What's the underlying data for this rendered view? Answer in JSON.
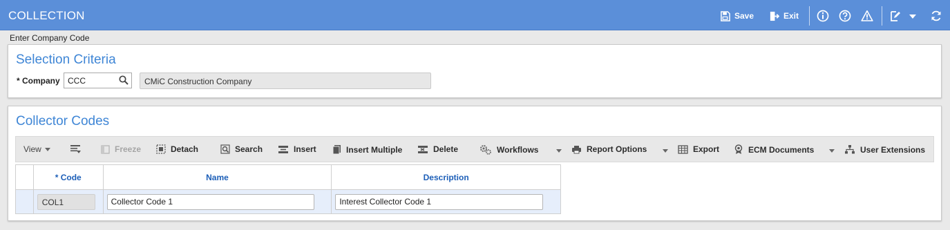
{
  "header": {
    "title": "COLLECTION",
    "save_label": "Save",
    "exit_label": "Exit",
    "bg_color": "#5b8fd9"
  },
  "hint": "Enter Company Code",
  "selection": {
    "title": "Selection Criteria",
    "company_label": "* Company",
    "company_value": "CCC",
    "company_name": "CMiC Construction Company"
  },
  "collector": {
    "title": "Collector Codes",
    "toolbar": {
      "view": "View",
      "freeze": "Freeze",
      "detach": "Detach",
      "search": "Search",
      "insert": "Insert",
      "insert_multiple": "Insert Multiple",
      "delete": "Delete",
      "workflows": "Workflows",
      "report_options": "Report Options",
      "export": "Export",
      "ecm_documents": "ECM Documents",
      "user_extensions": "User Extensions"
    },
    "columns": [
      "* Code",
      "Name",
      "Description"
    ],
    "rows": [
      {
        "code": "COL1",
        "name": "Collector Code 1",
        "description": "Interest Collector Code 1"
      }
    ]
  },
  "colors": {
    "accent": "#3f86d6",
    "header_text": "#1d5fb8",
    "selected_row": "#e6eefb"
  }
}
